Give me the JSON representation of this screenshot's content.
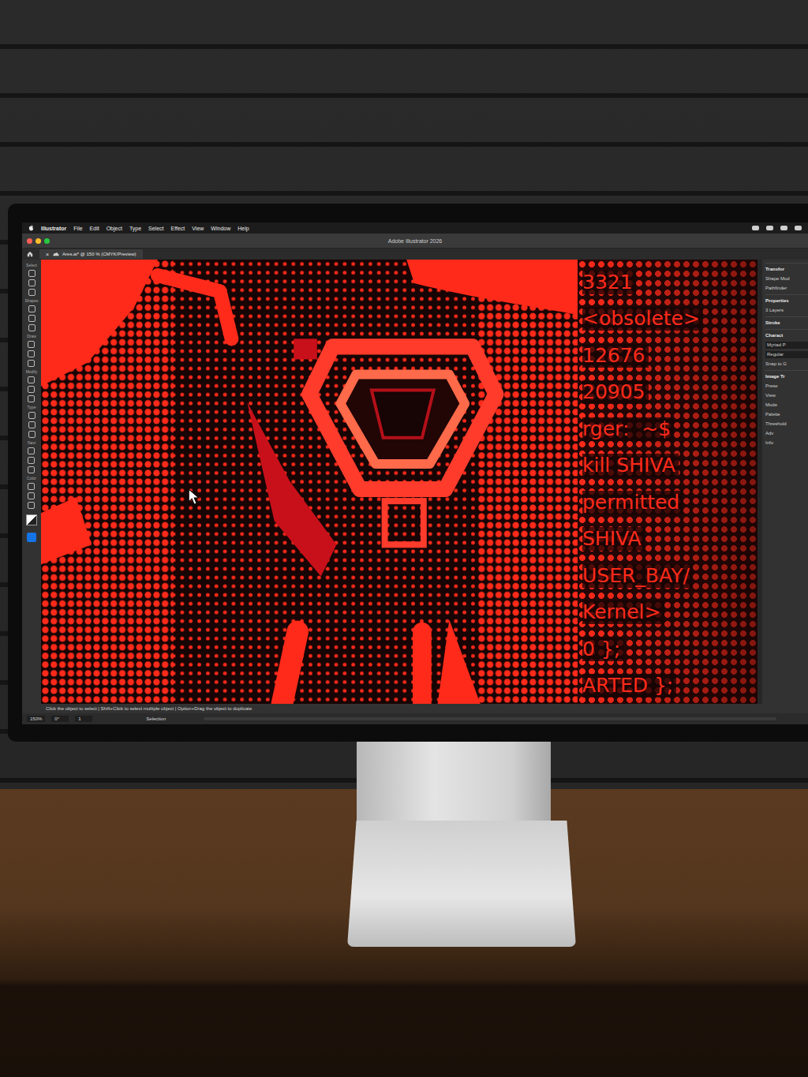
{
  "window": {
    "title": "Adobe Illustrator 2026"
  },
  "menu_bar": {
    "app": "Illustrator",
    "items": [
      "File",
      "Edit",
      "Object",
      "Type",
      "Select",
      "Effect",
      "View",
      "Window",
      "Help"
    ]
  },
  "document_tab": {
    "label": "Ares.ai* @ 150 % (CMYK/Preview)",
    "close": "×",
    "selected": true
  },
  "toolbar": {
    "sections": [
      {
        "label": "Select"
      },
      {
        "label": "Shapes"
      },
      {
        "label": "Draw"
      },
      {
        "label": "Modify"
      },
      {
        "label": "Type"
      },
      {
        "label": "Navi"
      },
      {
        "label": "Color"
      }
    ]
  },
  "artwork": {
    "code_lines": [
      "3321",
      "<obsolete>",
      "12676",
      "20905",
      "rger:  ~$",
      "kill SHIVA",
      "permitted",
      "SHIVA",
      "USER_BAY/",
      "Kernel>",
      "0 };",
      "ARTED };"
    ]
  },
  "right_panel": {
    "items": [
      {
        "label": "Transfor",
        "kind": "header"
      },
      {
        "label": "Shape Mod",
        "kind": "row"
      },
      {
        "label": "Pathfinder",
        "kind": "row"
      },
      {
        "label": "Properties",
        "kind": "header"
      },
      {
        "label": "3 Layers",
        "kind": "row"
      },
      {
        "label": "Stroke",
        "kind": "header"
      },
      {
        "label": "Charact",
        "kind": "header"
      },
      {
        "label": "Myriad P",
        "kind": "field"
      },
      {
        "label": "Regular",
        "kind": "field"
      },
      {
        "label": "Snap to G",
        "kind": "row"
      },
      {
        "label": "Image Tr",
        "kind": "header"
      },
      {
        "label": "Prese",
        "kind": "row"
      },
      {
        "label": "View",
        "kind": "row"
      },
      {
        "label": "Mode",
        "kind": "row"
      },
      {
        "label": "Palette",
        "kind": "row"
      },
      {
        "label": "Threshold",
        "kind": "row"
      },
      {
        "label": "Adv",
        "kind": "row"
      },
      {
        "label": "Info",
        "kind": "row"
      }
    ]
  },
  "status_bar": {
    "hint": "Click the object to select  |  Shift+Click to select multiple object  |  Option+Drag the object to duplicate",
    "zoom": "150%",
    "rotation": "0°",
    "artboard": "1",
    "tool": "Selection"
  }
}
